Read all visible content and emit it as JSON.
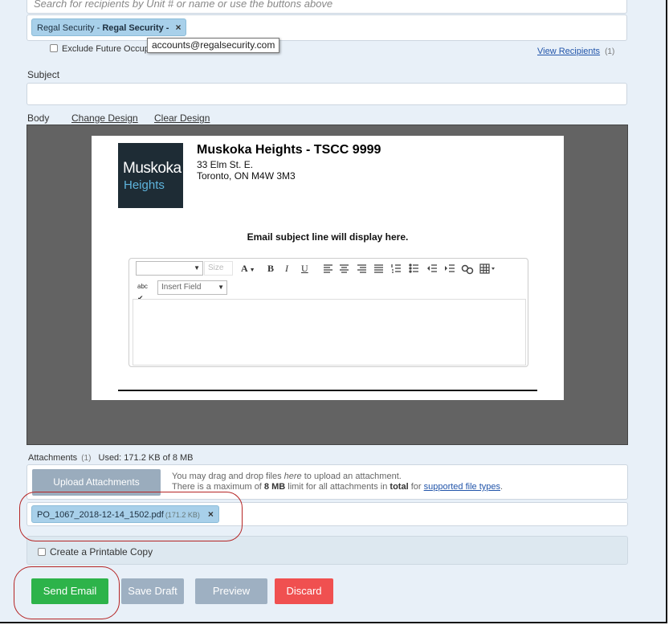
{
  "recipients": {
    "search_placeholder": "Search for recipients by Unit # or name or use the buttons above",
    "chip_prefix": "Regal Security - ",
    "chip_bold": "Regal Security -",
    "chip_remove": "×",
    "tooltip_email": "accounts@regalsecurity.com",
    "exclude_label": "Exclude Future Occupa",
    "view_recipients_label": "View Recipients",
    "view_recipients_count": "(1)"
  },
  "subject": {
    "label": "Subject",
    "value": ""
  },
  "body": {
    "label": "Body",
    "change_design": "Change Design",
    "clear_design": "Clear Design",
    "logo_line1": "Muskoka",
    "logo_line2": "Heights",
    "org_name": "Muskoka Heights - TSCC 9999",
    "address_line1": "33 Elm St. E.",
    "address_line2": "Toronto, ON M4W 3M3",
    "subject_placeholder": "Email subject line will display here.",
    "toolbar": {
      "size_placeholder": "Size",
      "font_color": "A",
      "bold": "B",
      "italic": "I",
      "underline": "U",
      "insert_field": "Insert Field",
      "spell": "abc"
    }
  },
  "attachments": {
    "label": "Attachments",
    "count": "(1)",
    "used": "Used: 171.2 KB of 8 MB",
    "upload_button": "Upload Attachments",
    "note_line1_a": "You may drag and drop files ",
    "note_line1_here": "here",
    "note_line1_b": " to upload an attachment.",
    "note_line2_a": "There is a maximum of ",
    "note_line2_limit": "8 MB",
    "note_line2_b": " limit for all attachments in ",
    "note_line2_total": "total",
    "note_line2_c": " for ",
    "note_line2_link": "supported file types",
    "note_line2_d": ".",
    "file_name": "PO_1067_2018-12-14_1502.pdf",
    "file_size": "(171.2 KB)",
    "file_remove": "×"
  },
  "printable_label": "Create a Printable Copy",
  "actions": {
    "send": "Send Email",
    "save_draft": "Save Draft",
    "preview": "Preview",
    "discard": "Discard"
  },
  "colors": {
    "page_bg": "#e8f0f8",
    "chip_bg": "#a8d0ea",
    "send": "#2db34a",
    "secondary": "#9eb0c2",
    "discard": "#f05050",
    "highlight_ring": "#b52424",
    "link": "#2255aa"
  }
}
